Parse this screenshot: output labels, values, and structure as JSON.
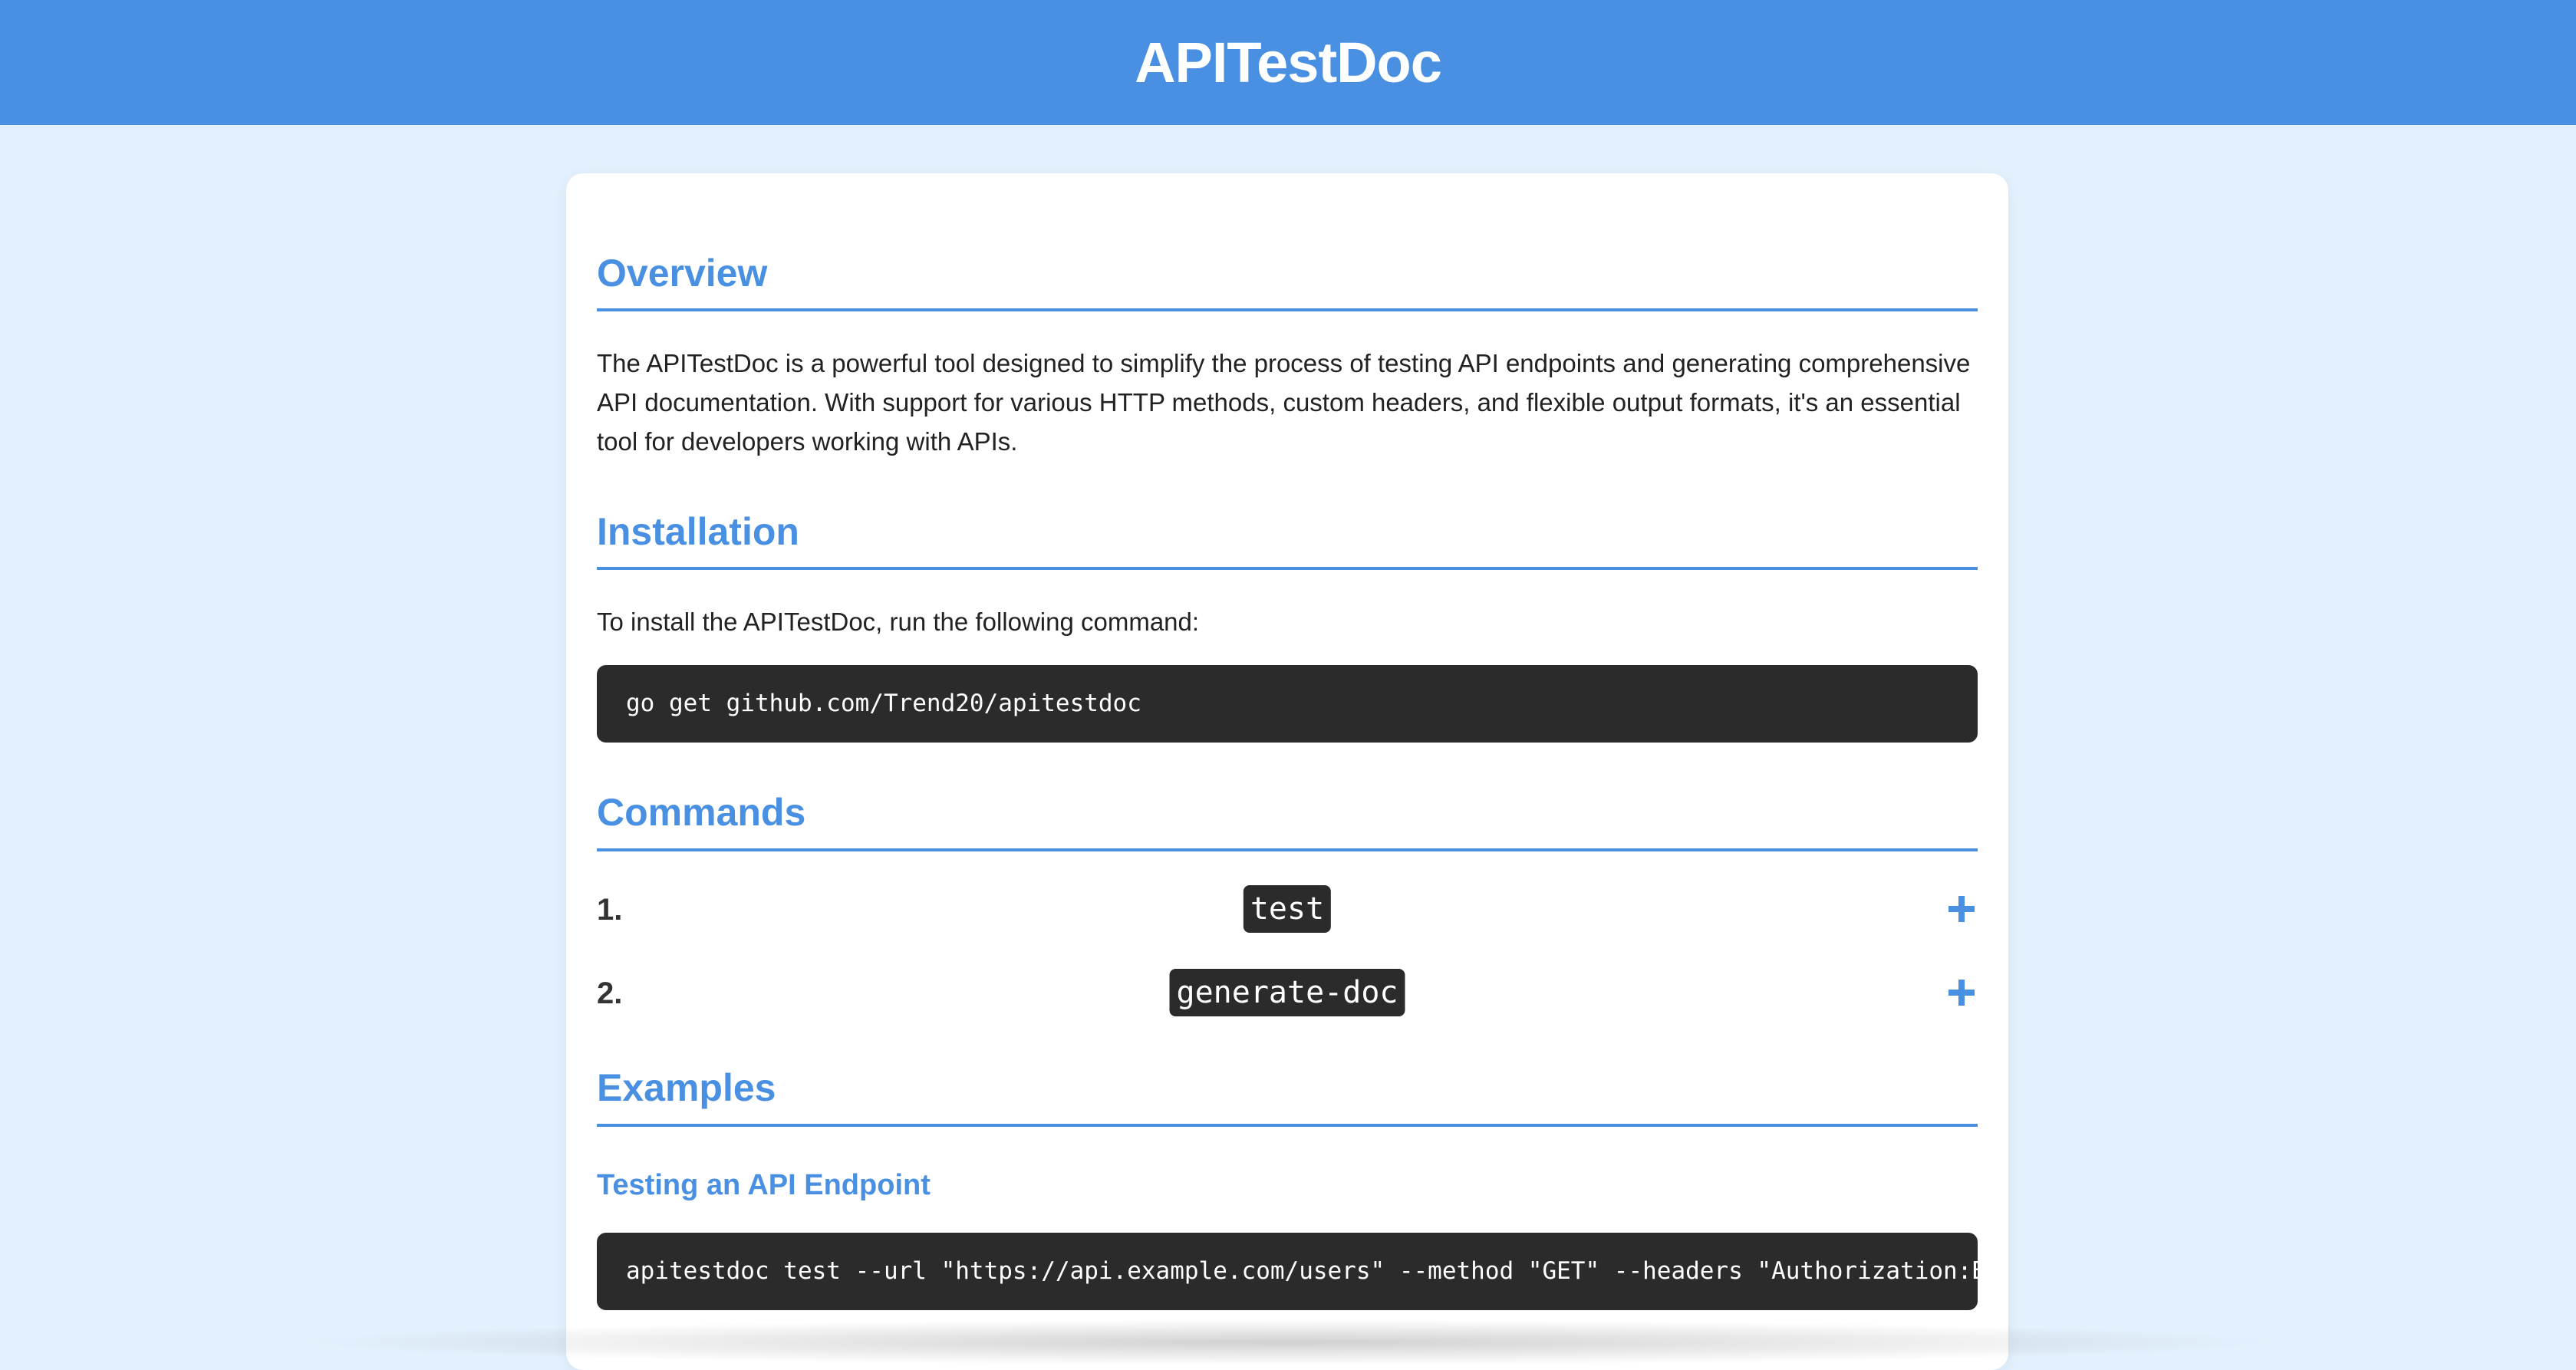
{
  "header": {
    "title": "APITestDoc"
  },
  "overview": {
    "heading": "Overview",
    "text": "The APITestDoc is a powerful tool designed to simplify the process of testing API endpoints and generating comprehensive API documentation. With support for various HTTP methods, custom headers, and flexible output formats, it's an essential tool for developers working with APIs."
  },
  "installation": {
    "heading": "Installation",
    "text": "To install the APITestDoc, run the following command:",
    "code": "go get github.com/Trend20/apitestdoc"
  },
  "commands": {
    "heading": "Commands",
    "items": [
      {
        "number": "1.",
        "name": "test",
        "toggle_icon": "plus-icon"
      },
      {
        "number": "2.",
        "name": "generate-doc",
        "toggle_icon": "plus-icon"
      }
    ]
  },
  "examples": {
    "heading": "Examples",
    "sub_heading": "Testing an API Endpoint",
    "code": "apitestdoc test --url \"https://api.example.com/users\" --method \"GET\" --headers \"Authorization:Bearer"
  },
  "colors": {
    "accent": "#4a90e2",
    "page_background": "#e3f0fd",
    "code_background": "#2b2b2b"
  }
}
